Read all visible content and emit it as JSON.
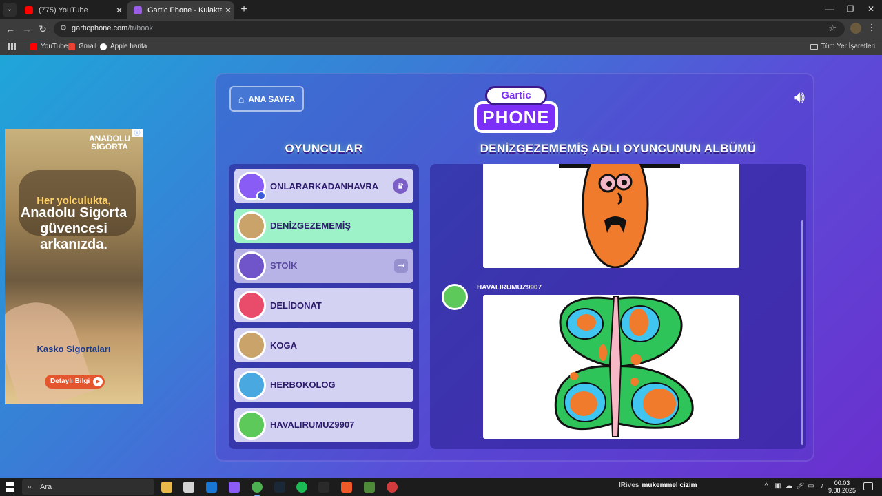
{
  "browser": {
    "tabs": [
      {
        "title": "(775) YouTube",
        "color": "#ff0000"
      },
      {
        "title": "Gartic Phone - Kulaktan Kulağa",
        "color": "#9b5de5"
      }
    ],
    "url_host": "garticphone.com",
    "url_path": "/tr/book",
    "bookmarks": [
      {
        "label": "YouTube",
        "color": "#ff0000"
      },
      {
        "label": "Gmail",
        "color": "#ea4335"
      },
      {
        "label": "Apple harita",
        "color": "#ffffff"
      }
    ],
    "all_bookmarks": "Tüm Yer İşaretleri"
  },
  "ad": {
    "brand_line1": "ANADOLU",
    "brand_line2": "SIGORTA",
    "headline_small": "Her yolculukta,",
    "headline_big": "Anadolu Sigorta güvencesi arkanızda.",
    "product": "Kasko Sigortaları",
    "cta": "Detaylı Bilgi"
  },
  "game": {
    "home_label": "ANA SAYFA",
    "logo_top": "Gartic",
    "logo_bottom": "PHONE",
    "players_title": "OYUNCULAR",
    "album_title": "DENİZGEZEMEMİŞ ADLI OYUNCUNUN ALBÜMÜ",
    "players": [
      {
        "name": "ONLARARKADANHAVRA",
        "state": "host",
        "avatar_color": "#8a5cf6"
      },
      {
        "name": "DENİZGEZEMEMİŞ",
        "state": "active",
        "avatar_color": "#c9a36a"
      },
      {
        "name": "STOİK",
        "state": "left",
        "avatar_color": "#6f55c9"
      },
      {
        "name": "DELİDONAT",
        "state": "normal",
        "avatar_color": "#e94b6a"
      },
      {
        "name": "KOGA",
        "state": "normal",
        "avatar_color": "#c9a36a"
      },
      {
        "name": "HERBOKOLOG",
        "state": "normal",
        "avatar_color": "#4aa8e0"
      },
      {
        "name": "HAVALIRUMUZ9907",
        "state": "normal",
        "avatar_color": "#5cc95a"
      }
    ],
    "album_author": "HAVALIRUMUZ9907"
  },
  "taskbar": {
    "search": "Ara",
    "notice_user": "IRives",
    "notice_text": "mukemmel cizim",
    "time": "00:03",
    "date": "9.08.2025"
  }
}
